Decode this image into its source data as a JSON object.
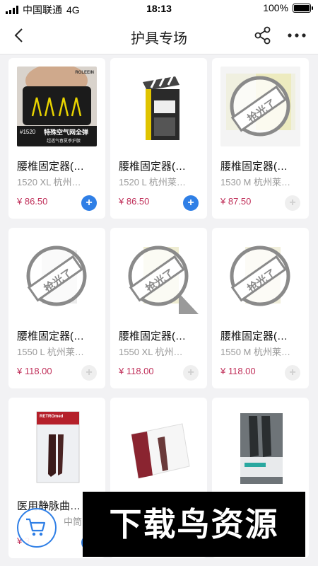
{
  "status_bar": {
    "carrier": "中国联通",
    "network": "4G",
    "time": "18:13",
    "battery": "100%",
    "battery_level": 1.0
  },
  "nav": {
    "title": "护具专场",
    "back_icon": "chevron-left-icon",
    "share_icon": "share-icon",
    "more_icon": "more-dots-icon"
  },
  "sold_out_label": "抢光了",
  "products": [
    {
      "name": "腰椎固定器(…",
      "spec": "1520 XL 杭州…",
      "price": "¥ 86.50",
      "available": true,
      "image_text": "特殊空气网全弹",
      "image_subtext": "超透气春夏季护腰",
      "image_brand": "ROLEEIN",
      "image_code": "#1520"
    },
    {
      "name": "腰椎固定器(…",
      "spec": "1520 L 杭州莱…",
      "price": "¥ 86.50",
      "available": true
    },
    {
      "name": "腰椎固定器(…",
      "spec": "1530 M 杭州莱…",
      "price": "¥ 87.50",
      "available": false
    },
    {
      "name": "腰椎固定器(…",
      "spec": "1550 L 杭州莱…",
      "price": "¥ 118.00",
      "available": false
    },
    {
      "name": "腰椎固定器(…",
      "spec": "1550 XL 杭州…",
      "price": "¥ 118.00",
      "available": false
    },
    {
      "name": "腰椎固定器(…",
      "spec": "1550 M 杭州莱…",
      "price": "¥ 118.00",
      "available": false
    },
    {
      "name": "医用静脉曲…",
      "spec": "中筒…",
      "price": "¥ 3",
      "available": true,
      "image_brand": "RETROmed"
    },
    {
      "name": "",
      "spec": "",
      "price": "",
      "available": true
    },
    {
      "name": "",
      "spec": "",
      "price": "",
      "available": true
    }
  ],
  "floating_cart": {
    "icon": "cart-icon"
  },
  "watermark": {
    "text": "下载鸟资源"
  },
  "colors": {
    "accent": "#2f7fe6",
    "price": "#c0305a"
  }
}
